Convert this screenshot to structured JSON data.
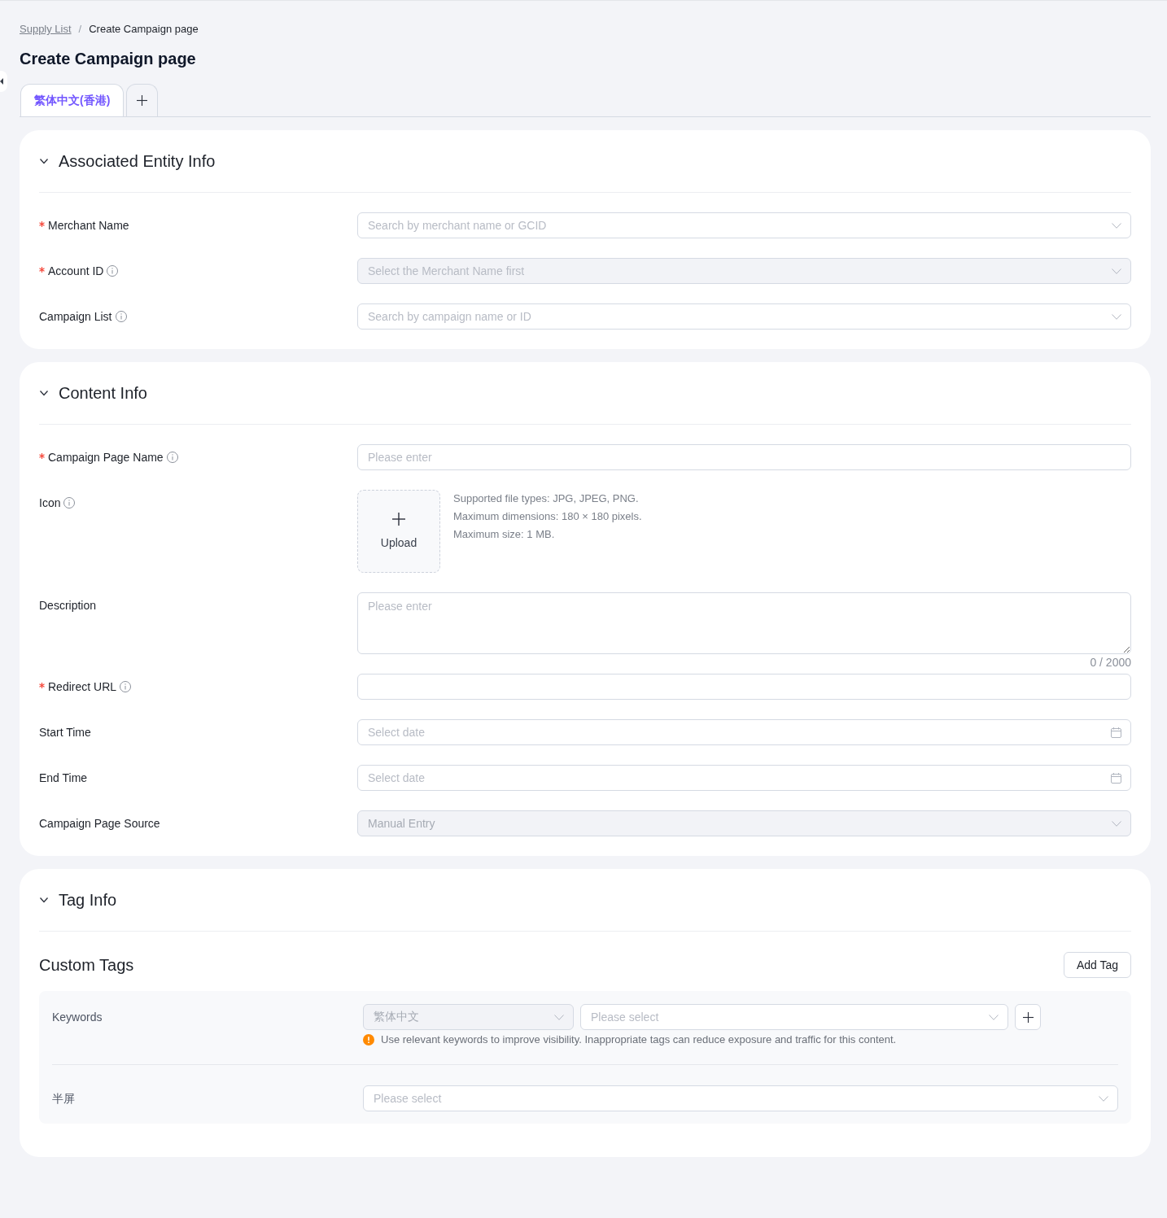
{
  "breadcrumb": {
    "items": [
      {
        "label": "Supply List",
        "kind": "link"
      },
      {
        "label": "Create Campaign page",
        "kind": "current"
      }
    ],
    "separator": "/"
  },
  "page_title": "Create Campaign page",
  "language_tabs": [
    {
      "label": "繁体中文(香港)",
      "selected": true
    }
  ],
  "sections": [
    {
      "kind": "form",
      "title": "Associated Entity Info",
      "expanded": true,
      "fields": [
        {
          "label": "Merchant Name",
          "required": true,
          "info": false,
          "kind": "select",
          "placeholder": "Search by merchant name or GCID",
          "disabled": false
        },
        {
          "label": "Account ID",
          "required": true,
          "info": true,
          "kind": "select",
          "placeholder": "Select the Merchant Name first",
          "disabled": true
        },
        {
          "label": "Campaign List",
          "required": false,
          "info": true,
          "kind": "select",
          "placeholder": "Search by campaign name or ID",
          "disabled": false
        }
      ]
    },
    {
      "kind": "form",
      "title": "Content Info",
      "expanded": true,
      "fields": [
        {
          "label": "Campaign Page Name",
          "required": true,
          "info": true,
          "kind": "input",
          "placeholder": "Please enter",
          "disabled": false
        },
        {
          "label": "Icon",
          "required": false,
          "info": true,
          "kind": "upload",
          "button_label": "Upload",
          "hints": [
            "Supported file types: JPG, JPEG, PNG.",
            "Maximum dimensions: 180 × 180 pixels.",
            "Maximum size: 1 MB."
          ]
        },
        {
          "label": "Description",
          "required": false,
          "info": false,
          "kind": "textarea",
          "placeholder": "Please enter",
          "counter": "0 / 2000",
          "disabled": false
        },
        {
          "label": "Redirect URL",
          "required": true,
          "info": true,
          "kind": "input",
          "disabled": false
        },
        {
          "label": "Start Time",
          "required": false,
          "info": false,
          "kind": "date",
          "placeholder": "Select date",
          "disabled": false
        },
        {
          "label": "End Time",
          "required": false,
          "info": false,
          "kind": "date",
          "placeholder": "Select date",
          "disabled": false
        },
        {
          "label": "Campaign Page Source",
          "required": false,
          "info": false,
          "kind": "select",
          "value": "Manual Entry",
          "disabled": true
        }
      ]
    },
    {
      "kind": "tags",
      "title": "Tag Info",
      "expanded": true,
      "subtitle": "Custom Tags",
      "add_button": "Add Tag",
      "rows": [
        {
          "kind": "keyword",
          "label": "Keywords",
          "language_select": {
            "value": "繁体中文",
            "disabled": true
          },
          "select": {
            "placeholder": "Please select",
            "disabled": false
          },
          "warning": "Use relevant keywords to improve visibility. Inappropriate tags can reduce exposure and traffic for this content."
        },
        {
          "kind": "select",
          "label": "半屏",
          "select": {
            "placeholder": "Please select",
            "disabled": false
          }
        }
      ]
    }
  ]
}
